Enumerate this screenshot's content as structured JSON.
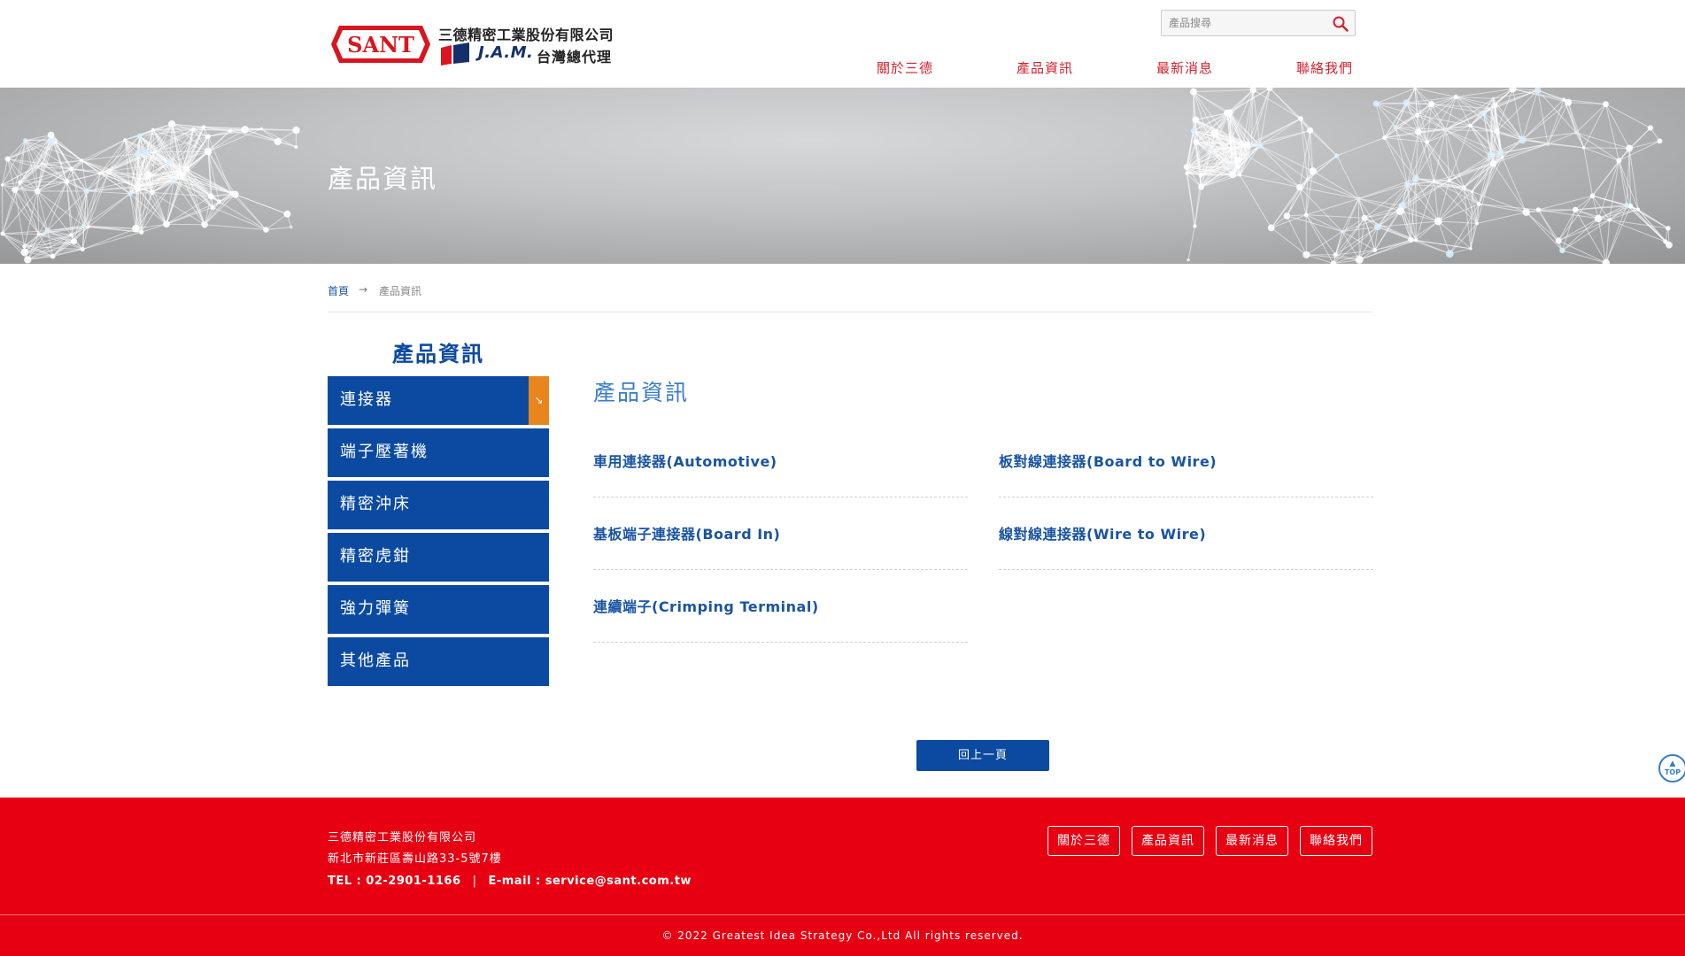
{
  "header": {
    "logo": {
      "sant_text": "SANT",
      "company_name": "三德精密工業股份有限公司",
      "jam_text": "J.A.M.",
      "agent_text": "台灣總代理"
    },
    "search": {
      "placeholder": "產品搜尋",
      "icon": "search-icon"
    },
    "nav": [
      "關於三德",
      "產品資訊",
      "最新消息",
      "聯絡我們"
    ]
  },
  "banner": {
    "title": "產品資訊"
  },
  "breadcrumb": {
    "home": "首頁",
    "separator": "→",
    "current": "產品資訊"
  },
  "sidebar": {
    "title": "產品資訊",
    "items": [
      {
        "label": "連接器",
        "badge": "↘",
        "active": true
      },
      {
        "label": "端子壓著機"
      },
      {
        "label": "精密沖床"
      },
      {
        "label": "精密虎鉗"
      },
      {
        "label": "強力彈簧"
      },
      {
        "label": "其他產品"
      }
    ]
  },
  "main": {
    "title": "產品資訊",
    "products": [
      "車用連接器(Automotive)",
      "板對線連接器(Board to Wire)",
      "基板端子連接器(Board In)",
      "線對線連接器(Wire to Wire)",
      "連續端子(Crimping Terminal)"
    ],
    "back_button": "回上一頁",
    "top_button": {
      "arrow": "▲",
      "label": "TOP"
    }
  },
  "footer": {
    "company": "三德精密工業股份有限公司",
    "address": "新北市新莊區壽山路33-5號7樓",
    "tel": "TEL : 02-2901-1166",
    "separator": "|",
    "email": "E-mail : service@sant.com.tw",
    "nav": [
      "關於三德",
      "產品資訊",
      "最新消息",
      "聯絡我們"
    ],
    "copyright": "© 2022 Greatest Idea Strategy Co.,Ltd All rights reserved."
  },
  "colors": {
    "brand_red": "#e60012",
    "nav_red": "#d21f2a",
    "brand_blue": "#0b4aa0",
    "link_blue": "#1a54a2",
    "accent_orange": "#e8851d"
  }
}
